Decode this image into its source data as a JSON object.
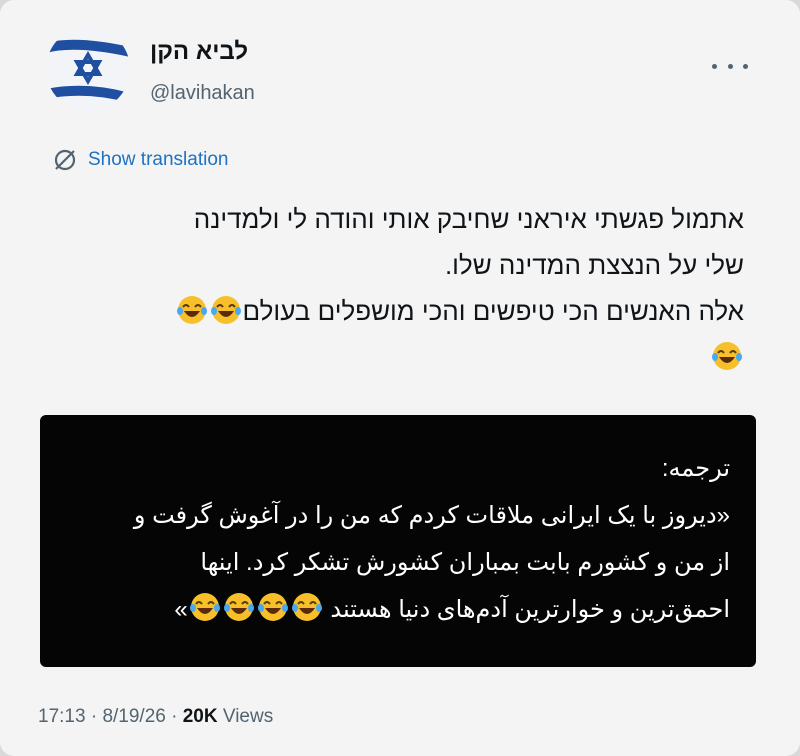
{
  "author": {
    "display_name": "לביא הקן",
    "handle": "@lavihakan",
    "avatar_icon": "israel-flag-icon"
  },
  "menu": {
    "icon": "more-options-icon"
  },
  "translate": {
    "icon": "globe-translate-icon",
    "label": "Show translation"
  },
  "post": {
    "lines": [
      "אתמול פגשתי איראני שחיבק אותי והודה לי ולמדינה",
      "שלי על הנצצת המדינה שלו.",
      "אלה האנשים הכי טיפשים והכי מושפלים בעולם"
    ],
    "emoji_icon": "laughing-tears-emoji-icon"
  },
  "media": {
    "lines": [
      "ترجمه:",
      "«دیروز با یک ایرانی ملاقات کردم که من را در آغوش گرفت و",
      "از من و کشورم بابت بمباران کشورش تشکر کرد. اینها",
      "احمق‌ترین و خوارترین آدم‌های دنیا هستند"
    ],
    "closing_quote": "»"
  },
  "meta": {
    "time": "17:13",
    "separator": "·",
    "date": "8/19/26",
    "views_count": "20K",
    "views_label": "Views"
  },
  "colors": {
    "link": "#1d72c2",
    "secondary_text": "#536471",
    "flag_blue": "#1f4fa0"
  }
}
